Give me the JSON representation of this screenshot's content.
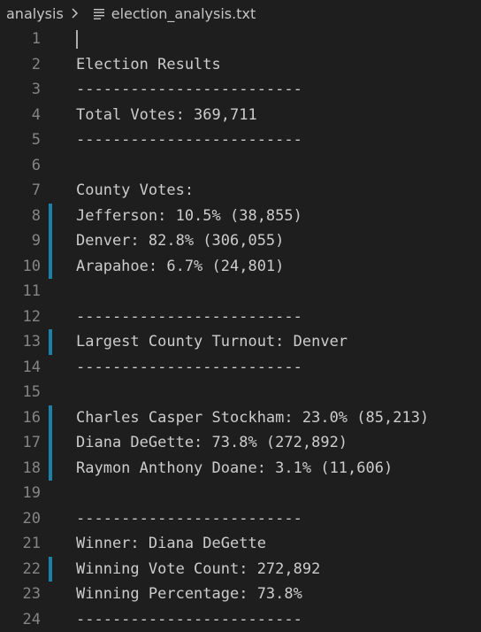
{
  "breadcrumb": {
    "folder": "analysis",
    "file": "election_analysis.txt",
    "separator_icon": "chevron-right-icon",
    "file_icon": "text-file-icon"
  },
  "colors": {
    "background": "#1e1e1e",
    "text": "#cccccc",
    "line_number": "#858585",
    "modified_gutter": "#1b81a8"
  },
  "lines": [
    {
      "n": "1",
      "text": "",
      "modified": false
    },
    {
      "n": "2",
      "text": "Election Results",
      "modified": false
    },
    {
      "n": "3",
      "text": "-------------------------",
      "modified": false
    },
    {
      "n": "4",
      "text": "Total Votes: 369,711",
      "modified": false
    },
    {
      "n": "5",
      "text": "-------------------------",
      "modified": false
    },
    {
      "n": "6",
      "text": "",
      "modified": false
    },
    {
      "n": "7",
      "text": "County Votes:",
      "modified": false
    },
    {
      "n": "8",
      "text": "Jefferson: 10.5% (38,855)",
      "modified": true
    },
    {
      "n": "9",
      "text": "Denver: 82.8% (306,055)",
      "modified": true
    },
    {
      "n": "10",
      "text": "Arapahoe: 6.7% (24,801)",
      "modified": true
    },
    {
      "n": "11",
      "text": "",
      "modified": false
    },
    {
      "n": "12",
      "text": "-------------------------",
      "modified": false
    },
    {
      "n": "13",
      "text": "Largest County Turnout: Denver",
      "modified": true
    },
    {
      "n": "14",
      "text": "-------------------------",
      "modified": false
    },
    {
      "n": "15",
      "text": "",
      "modified": false
    },
    {
      "n": "16",
      "text": "Charles Casper Stockham: 23.0% (85,213)",
      "modified": true
    },
    {
      "n": "17",
      "text": "Diana DeGette: 73.8% (272,892)",
      "modified": true
    },
    {
      "n": "18",
      "text": "Raymon Anthony Doane: 3.1% (11,606)",
      "modified": true
    },
    {
      "n": "19",
      "text": "",
      "modified": false
    },
    {
      "n": "20",
      "text": "-------------------------",
      "modified": false
    },
    {
      "n": "21",
      "text": "Winner: Diana DeGette",
      "modified": false
    },
    {
      "n": "22",
      "text": "Winning Vote Count: 272,892",
      "modified": true
    },
    {
      "n": "23",
      "text": "Winning Percentage: 73.8%",
      "modified": false
    },
    {
      "n": "24",
      "text": "-------------------------",
      "modified": false
    }
  ]
}
